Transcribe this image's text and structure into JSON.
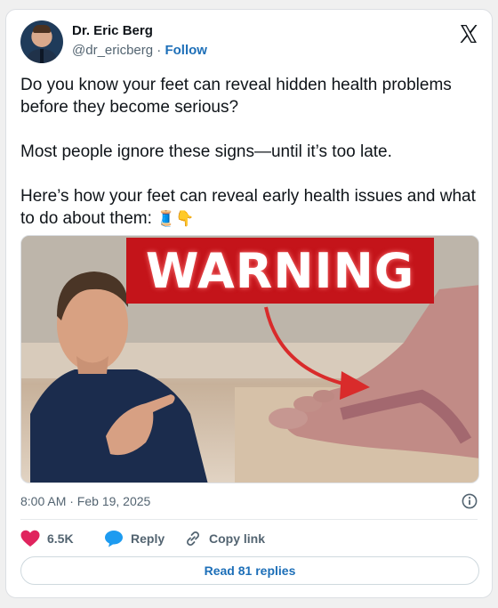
{
  "author": {
    "name": "Dr. Eric Berg",
    "handle": "@dr_ericberg",
    "separator": "·",
    "follow_label": "Follow"
  },
  "tweet": {
    "text": "Do you know your feet can reveal hidden health problems before they become serious?\n\nMost people ignore these signs—until it’s too late.\n\nHere’s how your feet can reveal early health issues and what to do about them: ",
    "emojis": "🧵👇"
  },
  "media": {
    "overlay_text": "WARNING"
  },
  "meta": {
    "timestamp": "8:00 AM · Feb 19, 2025"
  },
  "actions": {
    "likes": "6.5K",
    "reply_label": "Reply",
    "copy_link_label": "Copy link"
  },
  "replies_button": "Read 81 replies",
  "icons": {
    "platform": "x-logo-icon",
    "info": "info-icon",
    "like": "heart-icon",
    "reply": "speech-bubble-icon",
    "copy": "link-icon"
  },
  "colors": {
    "like": "#e0245e",
    "reply": "#1d9bf0",
    "link": "#1d6fb8",
    "warning_banner": "#c4141a"
  }
}
